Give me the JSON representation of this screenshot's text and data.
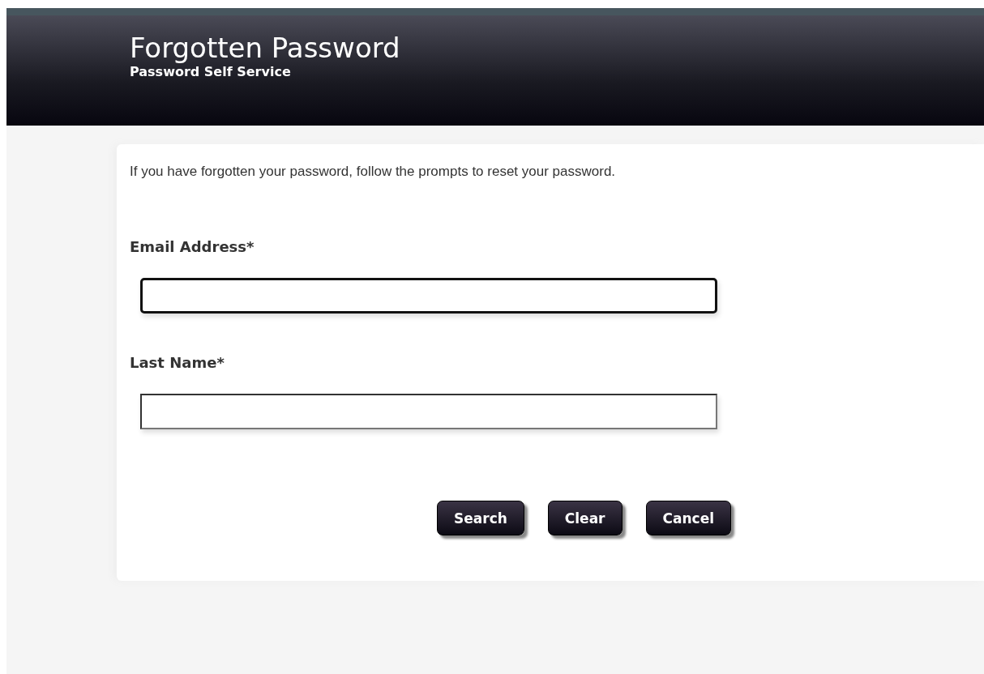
{
  "header": {
    "title": "Forgotten Password",
    "subtitle": "Password Self Service"
  },
  "intro": "If you have forgotten your password, follow the prompts to reset your password.",
  "fields": [
    {
      "label": "Email Address*",
      "focused": true
    },
    {
      "label": "Last Name*",
      "focused": false
    }
  ],
  "buttons": [
    "Search",
    "Clear",
    "Cancel"
  ]
}
